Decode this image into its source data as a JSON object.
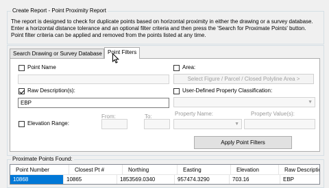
{
  "header": {
    "title": "Create Report - Point Proximity Report",
    "description": "The report is designed to check for duplicate points based on horizontal proximity in either the drawing or a survey database.  Enter a horizontal distance tolerance and an optional filter criteria and then press the 'Search for Proximate Points' button.  Point filter criteria can be applied and removed from the points listed at any time."
  },
  "tabs": [
    {
      "label": "Search Drawing or Survey Database",
      "active": false
    },
    {
      "label": "Point Filters",
      "active": true
    }
  ],
  "filters": {
    "point_name": {
      "label": "Point Name",
      "checked": false,
      "value": ""
    },
    "raw_description": {
      "label": "Raw Description(s):",
      "checked": true,
      "value": "EBP"
    },
    "elevation_range": {
      "label": "Elevation Range:",
      "checked": false,
      "from_label": "From:",
      "to_label": "To:",
      "from_value": "",
      "to_value": ""
    },
    "area": {
      "label": "Area:",
      "checked": false,
      "select_button": "Select Figure / Parcel / Closed Polyline Area >"
    },
    "user_defined": {
      "label": "User-Defined Property Classification:",
      "checked": false,
      "property_name_label": "Property Name:",
      "property_values_label": "Property Value(s):"
    },
    "apply_button": "Apply Point Filters"
  },
  "results": {
    "legend": "Proximate Points Found:",
    "columns": [
      "Point Number",
      "Closest Pt #",
      "Northing",
      "Easting",
      "Elevation",
      "Raw Description"
    ],
    "rows": [
      [
        "10868",
        "10865",
        "1853569.0340",
        "957474.3290",
        "703.16",
        "EBP"
      ]
    ]
  },
  "colors": {
    "selection": "#0078d7",
    "background": "#f0f0f0"
  }
}
